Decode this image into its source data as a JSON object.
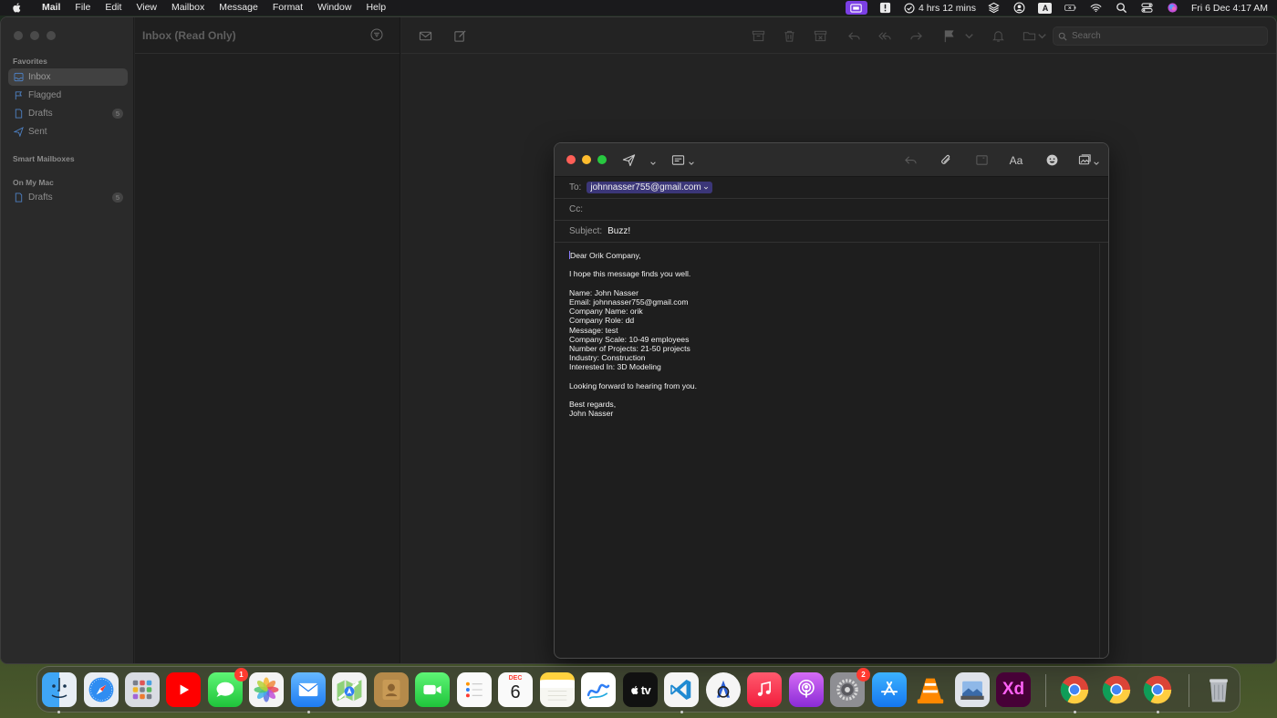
{
  "menubar": {
    "app_name": "Mail",
    "items": [
      "File",
      "Edit",
      "View",
      "Mailbox",
      "Message",
      "Format",
      "Window",
      "Help"
    ],
    "timer_text": "4 hrs 12 mins",
    "keyboard_label": "A",
    "datetime": "Fri 6 Dec  4:17 AM"
  },
  "sidebar": {
    "favorites_label": "Favorites",
    "favorites": [
      {
        "label": "Inbox",
        "icon": "inbox-icon"
      },
      {
        "label": "Flagged",
        "icon": "flag-icon"
      },
      {
        "label": "Drafts",
        "icon": "document-icon",
        "count": "5"
      },
      {
        "label": "Sent",
        "icon": "paperplane-icon"
      }
    ],
    "smart_mailboxes_label": "Smart Mailboxes",
    "on_my_mac_label": "On My Mac",
    "on_my_mac": [
      {
        "label": "Drafts",
        "icon": "document-icon",
        "count": "5"
      }
    ]
  },
  "message_list": {
    "title": "Inbox (Read Only)"
  },
  "viewer_toolbar": {
    "search_placeholder": "Search"
  },
  "compose": {
    "to_label": "To:",
    "to_value": "johnnasser755@gmail.com",
    "cc_label": "Cc:",
    "subject_label": "Subject:",
    "subject_value": "Buzz!",
    "format_label": "Aa",
    "body": {
      "greeting": "Dear Orik Company,",
      "intro": "I hope this message finds you well.",
      "details": [
        "Name: John Nasser",
        "Email: johnnasser755@gmail.com",
        "Company Name: orik",
        "Company Role: dd",
        "Message: test",
        "Company Scale: 10-49 employees",
        "Number of Projects: 21-50 projects",
        "Industry: Construction",
        "Interested In: 3D Modeling"
      ],
      "closing": "Looking forward to hearing from you.",
      "signoff": "Best regards,",
      "signature": "John Nasser"
    }
  },
  "dock": {
    "messages_badge": "1",
    "calendar_month": "DEC",
    "calendar_day": "6",
    "settings_badge": "2",
    "appletv_label": "tv",
    "xd_label": "Xd"
  },
  "colors": {
    "accent": "#7b3fe4",
    "token_bg": "#3b3678",
    "close": "#ff5f57",
    "minimize": "#febc2e",
    "zoom": "#28c840"
  }
}
